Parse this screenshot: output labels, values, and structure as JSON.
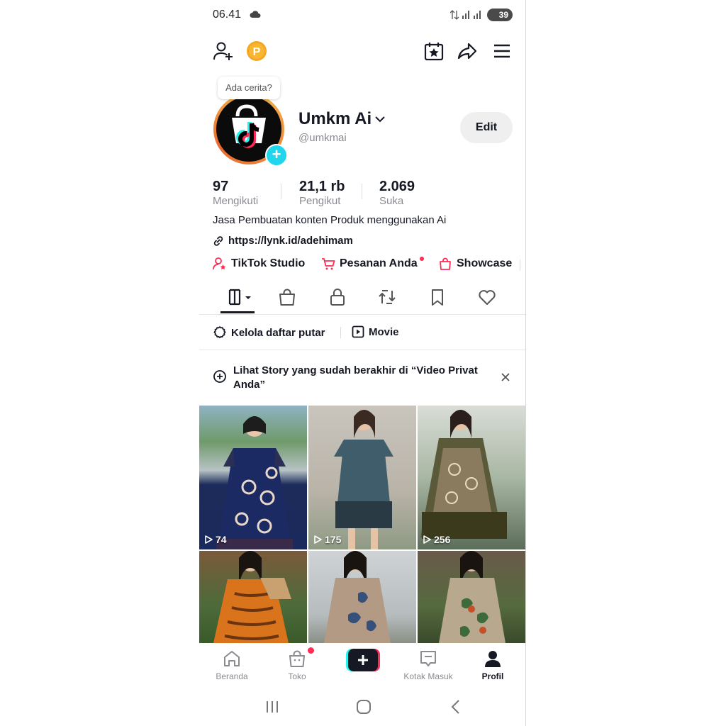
{
  "status_bar": {
    "time": "06.41",
    "battery": "39"
  },
  "profile": {
    "story_prompt": "Ada cerita?",
    "name": "Umkm Ai",
    "handle": "@umkmai",
    "edit_label": "Edit",
    "stats": [
      {
        "value": "97",
        "label": "Mengikuti"
      },
      {
        "value": "21,1 rb",
        "label": "Pengikut"
      },
      {
        "value": "2.069",
        "label": "Suka"
      }
    ],
    "bio": "Jasa Pembuatan konten Produk menggunakan Ai",
    "link": "https://lynk.id/adehimam"
  },
  "quick_links": {
    "studio": "TikTok Studio",
    "orders": "Pesanan Anda",
    "showcase": "Showcase"
  },
  "tabs": [
    "videos",
    "shop",
    "private",
    "reposts",
    "favorites",
    "liked"
  ],
  "filters": {
    "playlist": "Kelola daftar putar",
    "movie": "Movie"
  },
  "banner": {
    "text": "Lihat Story yang sudah berakhir di “Video Privat Anda”"
  },
  "videos": [
    {
      "views": "74"
    },
    {
      "views": "175"
    },
    {
      "views": "256"
    },
    {
      "views": ""
    },
    {
      "views": ""
    },
    {
      "views": ""
    }
  ],
  "bottom_nav": {
    "home": "Beranda",
    "shop": "Toko",
    "inbox": "Kotak Masuk",
    "profile": "Profil"
  },
  "colors": {
    "accent_cyan": "#20d5ec",
    "accent_red": "#fe2c55",
    "coin": "#f5a623"
  }
}
